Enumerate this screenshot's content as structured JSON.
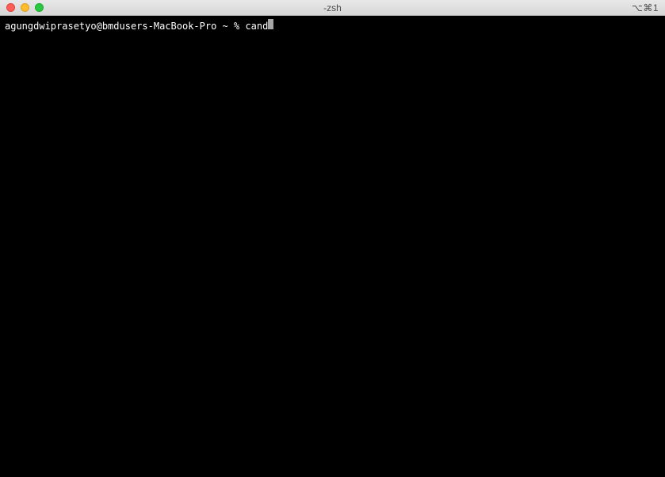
{
  "window": {
    "title": "-zsh",
    "right_indicator": "⌥⌘1"
  },
  "terminal": {
    "prompt": "agungdwiprasetyo@bmdusers-MacBook-Pro ~ % ",
    "command": "cand"
  }
}
